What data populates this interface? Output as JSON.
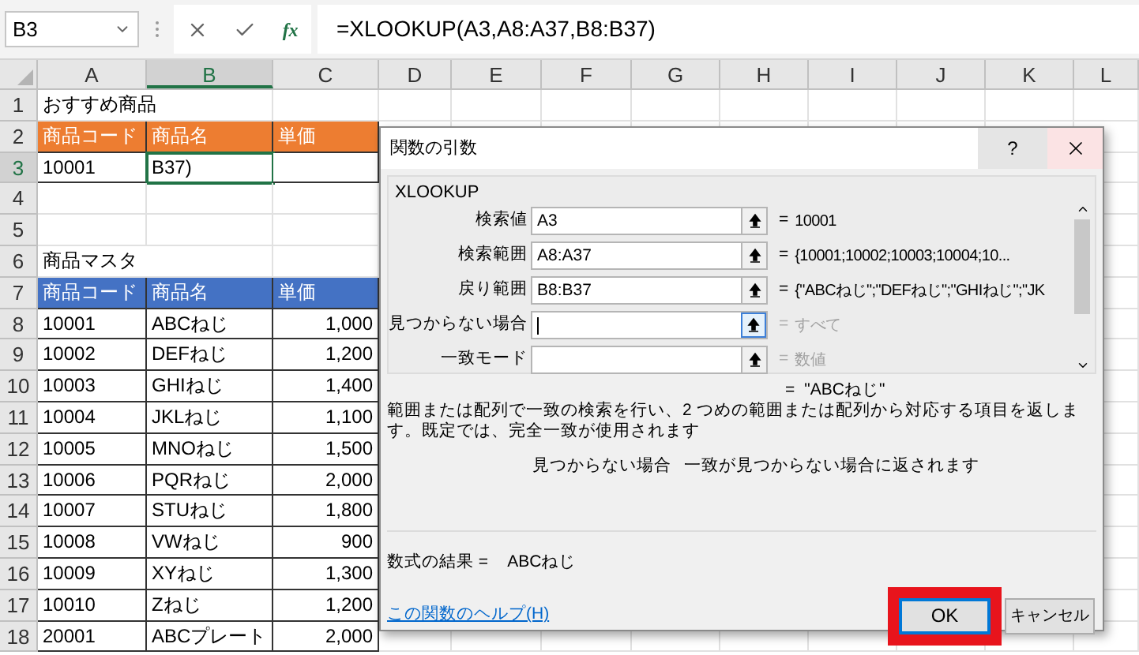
{
  "name_box": {
    "value": "B3"
  },
  "formula_bar": {
    "fx_label": "fx",
    "formula": "=XLOOKUP(A3,A8:A37,B8:B37)"
  },
  "columns": [
    {
      "label": "A",
      "selected": false
    },
    {
      "label": "B",
      "selected": true
    },
    {
      "label": "C",
      "selected": false
    },
    {
      "label": "D",
      "selected": false
    },
    {
      "label": "E",
      "selected": false
    },
    {
      "label": "F",
      "selected": false
    },
    {
      "label": "G",
      "selected": false
    },
    {
      "label": "H",
      "selected": false
    },
    {
      "label": "I",
      "selected": false
    },
    {
      "label": "J",
      "selected": false
    },
    {
      "label": "K",
      "selected": false
    },
    {
      "label": "L",
      "selected": false
    }
  ],
  "rows": [
    {
      "number": "1",
      "selected": false,
      "cells": [
        {
          "kind": "text",
          "text": "おすすめ商品"
        }
      ]
    },
    {
      "number": "2",
      "selected": false,
      "cells": [
        {
          "kind": "header_orange",
          "text": "商品コード"
        },
        {
          "kind": "header_orange",
          "text": "商品名"
        },
        {
          "kind": "header_orange",
          "text": "単価"
        }
      ]
    },
    {
      "number": "3",
      "selected": true,
      "cells": [
        {
          "kind": "boxed",
          "text": "10001"
        },
        {
          "kind": "boxed",
          "text": "B37)"
        },
        {
          "kind": "boxed"
        }
      ]
    },
    {
      "number": "4",
      "selected": false,
      "cells": []
    },
    {
      "number": "5",
      "selected": false,
      "cells": []
    },
    {
      "number": "6",
      "selected": false,
      "cells": [
        {
          "kind": "text",
          "text": "商品マスタ"
        }
      ]
    },
    {
      "number": "7",
      "selected": false,
      "cells": [
        {
          "kind": "header_blue",
          "text": "商品コード"
        },
        {
          "kind": "header_blue",
          "text": "商品名"
        },
        {
          "kind": "header_blue",
          "text": "単価"
        }
      ]
    },
    {
      "number": "8",
      "selected": false,
      "cells": [
        {
          "kind": "boxed",
          "text": "10001"
        },
        {
          "kind": "boxed",
          "text": "ABCねじ"
        },
        {
          "kind": "number",
          "text": "1,000"
        }
      ]
    },
    {
      "number": "9",
      "selected": false,
      "cells": [
        {
          "kind": "boxed",
          "text": "10002"
        },
        {
          "kind": "boxed",
          "text": "DEFねじ"
        },
        {
          "kind": "number",
          "text": "1,200"
        }
      ]
    },
    {
      "number": "10",
      "selected": false,
      "cells": [
        {
          "kind": "boxed",
          "text": "10003"
        },
        {
          "kind": "boxed",
          "text": "GHIねじ"
        },
        {
          "kind": "number",
          "text": "1,400"
        }
      ]
    },
    {
      "number": "11",
      "selected": false,
      "cells": [
        {
          "kind": "boxed",
          "text": "10004"
        },
        {
          "kind": "boxed",
          "text": "JKLねじ"
        },
        {
          "kind": "number",
          "text": "1,100"
        }
      ]
    },
    {
      "number": "12",
      "selected": false,
      "cells": [
        {
          "kind": "boxed",
          "text": "10005"
        },
        {
          "kind": "boxed",
          "text": "MNOねじ"
        },
        {
          "kind": "number",
          "text": "1,500"
        }
      ]
    },
    {
      "number": "13",
      "selected": false,
      "cells": [
        {
          "kind": "boxed",
          "text": "10006"
        },
        {
          "kind": "boxed",
          "text": "PQRねじ"
        },
        {
          "kind": "number",
          "text": "2,000"
        }
      ]
    },
    {
      "number": "14",
      "selected": false,
      "cells": [
        {
          "kind": "boxed",
          "text": "10007"
        },
        {
          "kind": "boxed",
          "text": "STUねじ"
        },
        {
          "kind": "number",
          "text": "1,800"
        }
      ]
    },
    {
      "number": "15",
      "selected": false,
      "cells": [
        {
          "kind": "boxed",
          "text": "10008"
        },
        {
          "kind": "boxed",
          "text": "VWねじ"
        },
        {
          "kind": "number",
          "text": "900"
        }
      ]
    },
    {
      "number": "16",
      "selected": false,
      "cells": [
        {
          "kind": "boxed",
          "text": "10009"
        },
        {
          "kind": "boxed",
          "text": "XYねじ"
        },
        {
          "kind": "number",
          "text": "1,300"
        }
      ]
    },
    {
      "number": "17",
      "selected": false,
      "cells": [
        {
          "kind": "boxed",
          "text": "10010"
        },
        {
          "kind": "boxed",
          "text": "Zねじ"
        },
        {
          "kind": "number",
          "text": "1,200"
        }
      ]
    },
    {
      "number": "18",
      "selected": false,
      "cells": [
        {
          "kind": "boxed",
          "text": "20001"
        },
        {
          "kind": "boxed",
          "text": "ABCプレート"
        },
        {
          "kind": "number",
          "text": "2,000"
        }
      ]
    }
  ],
  "dialog": {
    "title": "関数の引数",
    "help_button": "?",
    "function_name": "XLOOKUP",
    "arguments": [
      {
        "label": "検索値",
        "value": "A3",
        "focused": false,
        "equals": "=",
        "result": "10001",
        "result_muted": false
      },
      {
        "label": "検索範囲",
        "value": "A8:A37",
        "focused": false,
        "equals": "=",
        "result": "{10001;10002;10003;10004;10...",
        "result_muted": false
      },
      {
        "label": "戻り範囲",
        "value": "B8:B37",
        "focused": false,
        "equals": "=",
        "result": "{\"ABCねじ\";\"DEFねじ\";\"GHIねじ\";\"JK",
        "result_muted": false
      },
      {
        "label": "見つからない場合",
        "focused": true,
        "equals": "=",
        "result": "すべて",
        "result_muted": true
      },
      {
        "label": "一致モード",
        "focused": false,
        "equals": "=",
        "result": "数値",
        "result_muted": true
      }
    ],
    "overall_equals": "=",
    "overall_result": "\"ABCねじ\"",
    "description": "範囲または配列で一致の検索を行い、2 つめの範囲または配列から対応する項目を返します。既定では、完全一致が使用されます",
    "argument_name": "見つからない場合",
    "argument_help": "一致が見つからない場合に返されます",
    "formula_result_label": "数式の結果 =",
    "formula_result": "ABCねじ",
    "help_link": "この関数のヘルプ(H)",
    "ok_button": {
      "label": "OK",
      "highlighted": true
    },
    "cancel_button": {
      "label": "キャンセル"
    }
  }
}
